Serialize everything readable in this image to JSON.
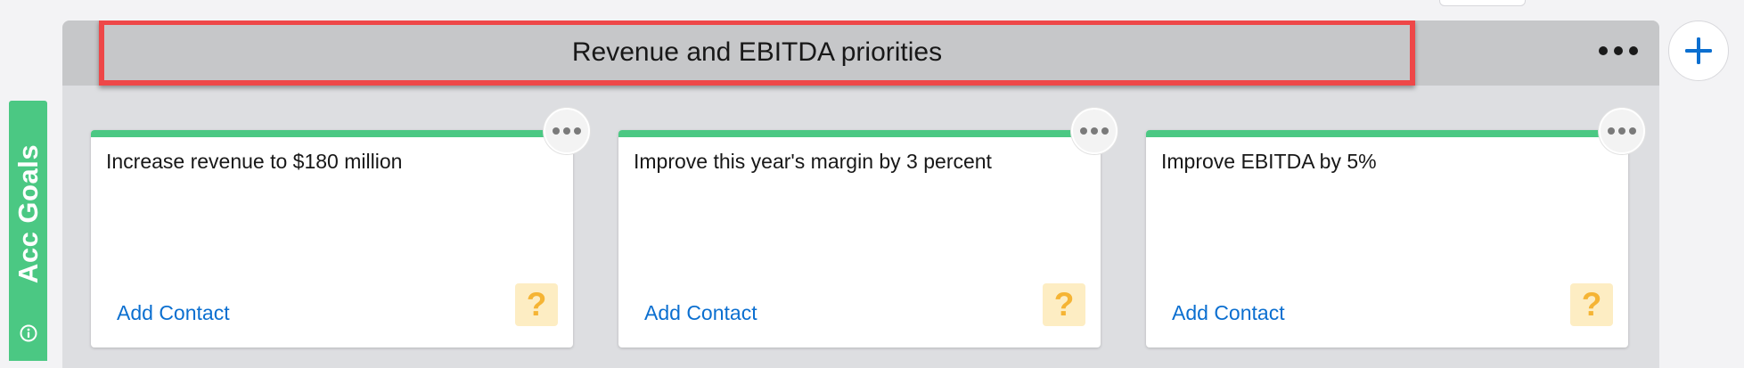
{
  "side_tab": {
    "label": "Acc Goals",
    "icon": "info-icon",
    "color": "#4bc883"
  },
  "board": {
    "title": "Revenue and EBITDA priorities",
    "more_icon": "more-horizontal-icon",
    "highlight_color": "#ee4748"
  },
  "cards": [
    {
      "title": "Increase revenue to $180 million",
      "action_label": "Add Contact",
      "badge": "?"
    },
    {
      "title": "Improve this year's margin by 3 percent",
      "action_label": "Add Contact",
      "badge": "?"
    },
    {
      "title": "Improve EBITDA by 5%",
      "action_label": "Add Contact",
      "badge": "?"
    }
  ],
  "add_button": {
    "icon": "plus-icon",
    "color": "#0b6fd0"
  }
}
